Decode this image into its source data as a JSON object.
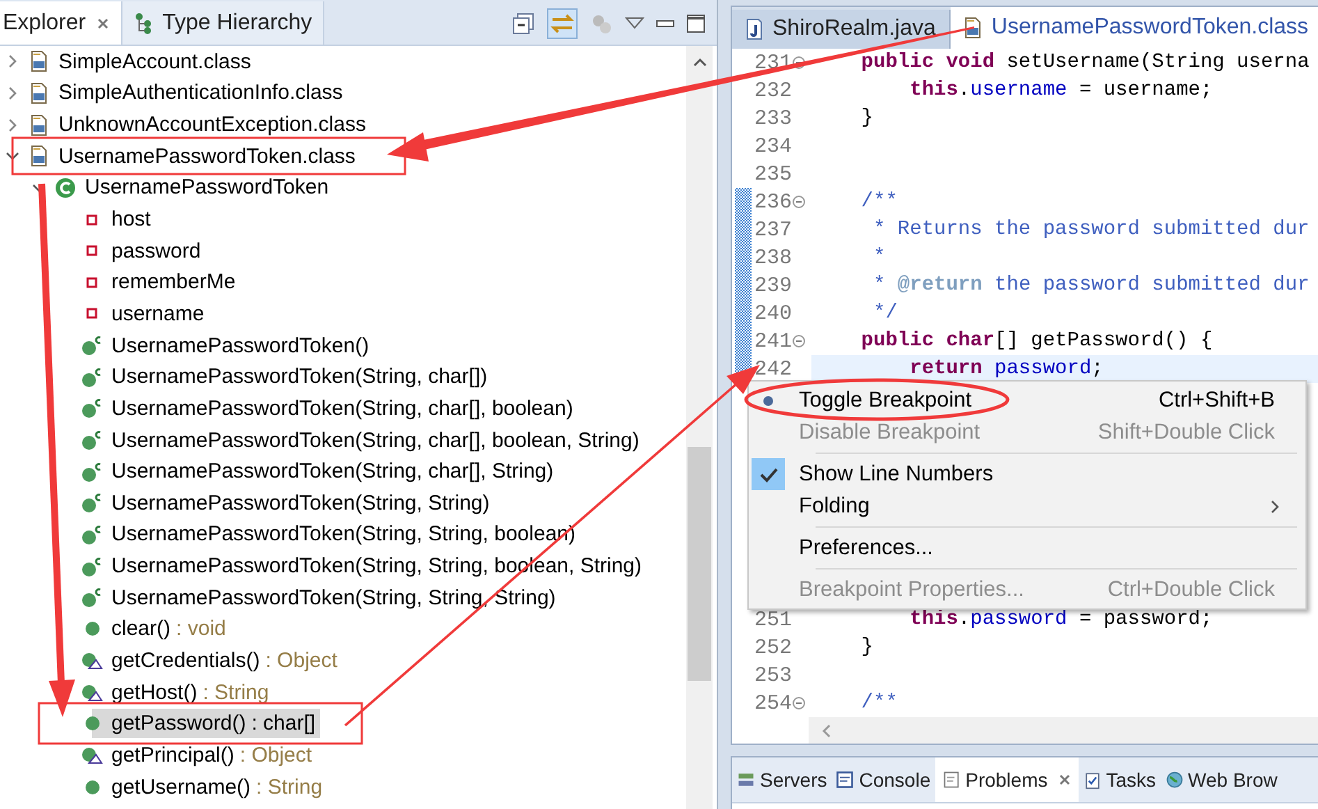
{
  "explorer": {
    "tabs": [
      {
        "label": "Explorer",
        "selected": true,
        "closable": true
      },
      {
        "label": "Type Hierarchy",
        "selected": false,
        "closable": false
      }
    ],
    "tree": [
      {
        "kind": "class-file",
        "label": "SimpleAccount.class",
        "expanded": false,
        "selected": false
      },
      {
        "kind": "class-file",
        "label": "SimpleAuthenticationInfo.class",
        "expanded": false,
        "selected": false
      },
      {
        "kind": "class-file",
        "label": "UnknownAccountException.class",
        "expanded": false,
        "selected": false
      },
      {
        "kind": "class-file",
        "label": "UsernamePasswordToken.class",
        "expanded": true,
        "selected": false,
        "children": [
          {
            "kind": "class",
            "label": "UsernamePasswordToken",
            "expanded": true,
            "selected": false,
            "children": [
              {
                "kind": "field",
                "label": "host",
                "selected": false
              },
              {
                "kind": "field",
                "label": "password",
                "selected": false
              },
              {
                "kind": "field",
                "label": "rememberMe",
                "selected": false
              },
              {
                "kind": "field",
                "label": "username",
                "selected": false
              },
              {
                "kind": "constructor",
                "label": "UsernamePasswordToken()",
                "selected": false
              },
              {
                "kind": "constructor",
                "label": "UsernamePasswordToken(String, char[])",
                "selected": false
              },
              {
                "kind": "constructor",
                "label": "UsernamePasswordToken(String, char[], boolean)",
                "selected": false
              },
              {
                "kind": "constructor",
                "label": "UsernamePasswordToken(String, char[], boolean, String)",
                "selected": false
              },
              {
                "kind": "constructor",
                "label": "UsernamePasswordToken(String, char[], String)",
                "selected": false
              },
              {
                "kind": "constructor",
                "label": "UsernamePasswordToken(String, String)",
                "selected": false
              },
              {
                "kind": "constructor",
                "label": "UsernamePasswordToken(String, String, boolean)",
                "selected": false
              },
              {
                "kind": "constructor",
                "label": "UsernamePasswordToken(String, String, boolean, String)",
                "selected": false
              },
              {
                "kind": "constructor",
                "label": "UsernamePasswordToken(String, String, String)",
                "selected": false
              },
              {
                "kind": "method",
                "label": "clear()",
                "type": ": void",
                "selected": false
              },
              {
                "kind": "implementing-method",
                "label": "getCredentials()",
                "type": ": Object",
                "selected": false
              },
              {
                "kind": "implementing-method",
                "label": "getHost()",
                "type": ": String",
                "selected": false
              },
              {
                "kind": "method",
                "label": "getPassword()",
                "type": ": char[]",
                "selected": true
              },
              {
                "kind": "implementing-method",
                "label": "getPrincipal()",
                "type": ": Object",
                "selected": false
              },
              {
                "kind": "method",
                "label": "getUsername()",
                "type": ": String",
                "selected": false
              }
            ]
          }
        ]
      }
    ]
  },
  "editor": {
    "tabs": [
      {
        "kind": "java",
        "label": "ShiroRealm.java",
        "selected": false
      },
      {
        "kind": "class-file",
        "label": "UsernamePasswordToken.class",
        "selected": true
      }
    ],
    "lines": [
      {
        "number": "231",
        "fold": true,
        "marked": false,
        "current": false,
        "tokens": [
          {
            "kind": "keyword",
            "text": "    public"
          },
          {
            "kind": "keyword",
            "text": " void"
          },
          {
            "kind": "plain",
            "text": " setUsername(String userna"
          }
        ]
      },
      {
        "number": "232",
        "fold": false,
        "marked": false,
        "current": false,
        "tokens": [
          {
            "kind": "keyword",
            "text": "        this"
          },
          {
            "kind": "plain",
            "text": "."
          },
          {
            "kind": "field",
            "text": "username"
          },
          {
            "kind": "plain",
            "text": " = username;"
          }
        ]
      },
      {
        "number": "233",
        "fold": false,
        "marked": false,
        "current": false,
        "tokens": [
          {
            "kind": "plain",
            "text": "    }"
          }
        ]
      },
      {
        "number": "234",
        "fold": false,
        "marked": false,
        "current": false
      },
      {
        "number": "235",
        "fold": false,
        "marked": false,
        "current": false
      },
      {
        "number": "236",
        "fold": true,
        "marked": true,
        "current": false,
        "tokens": [
          {
            "kind": "comment",
            "text": "    /**"
          }
        ]
      },
      {
        "number": "237",
        "fold": false,
        "marked": true,
        "current": false,
        "tokens": [
          {
            "kind": "comment",
            "text": "     * Returns the password submitted dur"
          }
        ]
      },
      {
        "number": "238",
        "fold": false,
        "marked": true,
        "current": false,
        "tokens": [
          {
            "kind": "comment",
            "text": "     *"
          }
        ]
      },
      {
        "number": "239",
        "fold": false,
        "marked": true,
        "current": false,
        "tokens": [
          {
            "kind": "comment",
            "text": "     * "
          },
          {
            "kind": "tag",
            "text": "@return"
          },
          {
            "kind": "comment",
            "text": " the password submitted dur"
          }
        ]
      },
      {
        "number": "240",
        "fold": false,
        "marked": true,
        "current": false,
        "tokens": [
          {
            "kind": "comment",
            "text": "     */"
          }
        ]
      },
      {
        "number": "241",
        "fold": true,
        "marked": true,
        "current": false,
        "tokens": [
          {
            "kind": "keyword",
            "text": "    public"
          },
          {
            "kind": "keyword",
            "text": " char"
          },
          {
            "kind": "plain",
            "text": "[] getPassword() {"
          }
        ]
      },
      {
        "number": "242",
        "fold": false,
        "marked": true,
        "current": true,
        "tokens": [
          {
            "kind": "keyword",
            "text": "        return"
          },
          {
            "kind": "field",
            "text": " password"
          },
          {
            "kind": "plain",
            "text": ";"
          }
        ]
      },
      {
        "number": "251",
        "fold": false,
        "marked": false,
        "current": false,
        "tokens": [
          {
            "kind": "keyword",
            "text": "        this"
          },
          {
            "kind": "plain",
            "text": "."
          },
          {
            "kind": "field",
            "text": "password"
          },
          {
            "kind": "plain",
            "text": " = password;"
          }
        ]
      },
      {
        "number": "252",
        "fold": false,
        "marked": false,
        "current": false,
        "tokens": [
          {
            "kind": "plain",
            "text": "    }"
          }
        ]
      },
      {
        "number": "253",
        "fold": false,
        "marked": false,
        "current": false
      },
      {
        "number": "254",
        "fold": true,
        "marked": false,
        "current": false,
        "tokens": [
          {
            "kind": "comment",
            "text": "    /**"
          }
        ]
      }
    ]
  },
  "context_menu": [
    {
      "kind": "breakpoint",
      "label": "Toggle Breakpoint",
      "shortcut": "Ctrl+Shift+B",
      "disabled": false
    },
    {
      "kind": "item",
      "label": "Disable Breakpoint",
      "shortcut": "Shift+Double Click",
      "disabled": true
    },
    {
      "kind": "separator"
    },
    {
      "kind": "check",
      "label": "Show Line Numbers",
      "checked": true,
      "disabled": false
    },
    {
      "kind": "submenu",
      "label": "Folding",
      "disabled": false
    },
    {
      "kind": "separator"
    },
    {
      "kind": "item",
      "label": "Preferences...",
      "disabled": false
    },
    {
      "kind": "separator"
    },
    {
      "kind": "item",
      "label": "Breakpoint Properties...",
      "shortcut": "Ctrl+Double Click",
      "disabled": true
    }
  ],
  "bottom_panel": {
    "tabs": [
      {
        "kind": "servers",
        "label": "Servers",
        "selected": false,
        "closable": false
      },
      {
        "kind": "console",
        "label": "Console",
        "selected": false,
        "closable": false
      },
      {
        "kind": "problems",
        "label": "Problems",
        "selected": true,
        "closable": true
      },
      {
        "kind": "tasks",
        "label": "Tasks",
        "selected": false,
        "closable": false
      },
      {
        "kind": "browser",
        "label": "Web Brow",
        "selected": false,
        "closable": false
      }
    ]
  }
}
